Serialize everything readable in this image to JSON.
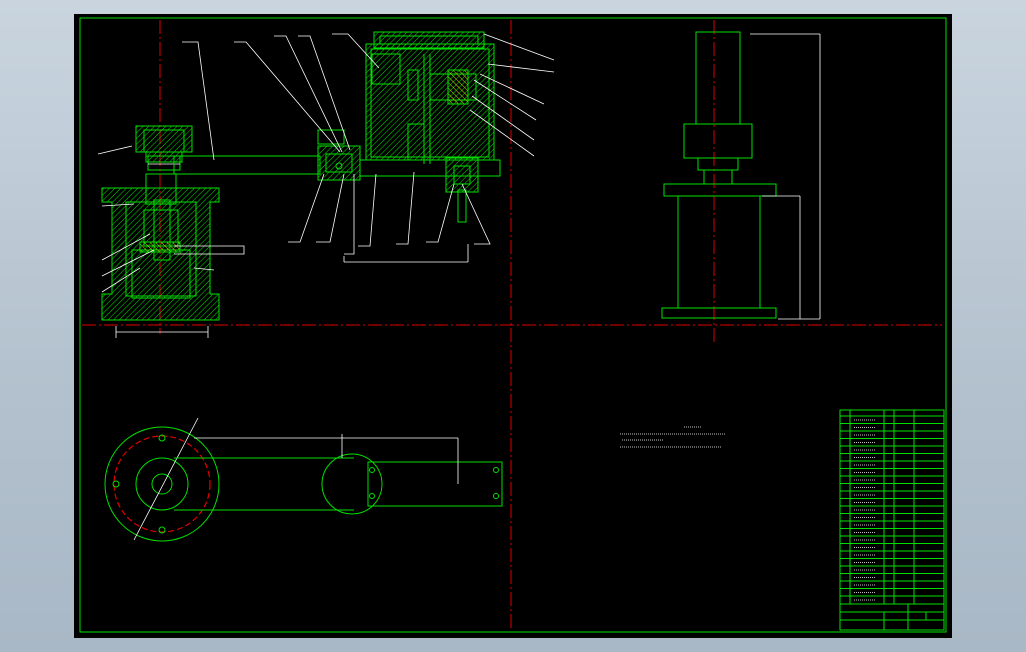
{
  "window": {
    "background_color": "#000000",
    "line_color": "#00e000",
    "centerline_color": "#e00000",
    "annotation_color": "#ffffff"
  },
  "drawing": {
    "views": [
      "front-section-view",
      "side-view",
      "top-view"
    ]
  }
}
